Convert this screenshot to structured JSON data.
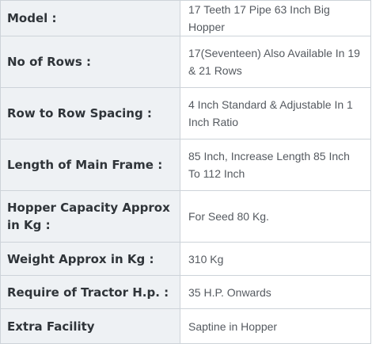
{
  "spec_table": {
    "rows": [
      {
        "key": "Model :",
        "value": "17 Teeth 17 Pipe 63 Inch Big Hopper"
      },
      {
        "key": "No of Rows :",
        "value": "17(Seventeen) Also Available In 19 & 21 Rows"
      },
      {
        "key": "Row to Row Spacing :",
        "value": "4 Inch Standard & Adjustable In 1 Inch Ratio"
      },
      {
        "key": "Length of Main Frame :",
        "value": "85 Inch, Increase Length 85 Inch To 112 Inch"
      },
      {
        "key": "Hopper Capacity Approx in Kg :",
        "value": "For Seed 80 Kg."
      },
      {
        "key": "Weight Approx in Kg :",
        "value": "310 Kg"
      },
      {
        "key": "Require of Tractor H.p. :",
        "value": "35 H.P. Onwards"
      },
      {
        "key": "Extra Facility",
        "value": "Saptine in Hopper"
      }
    ]
  }
}
